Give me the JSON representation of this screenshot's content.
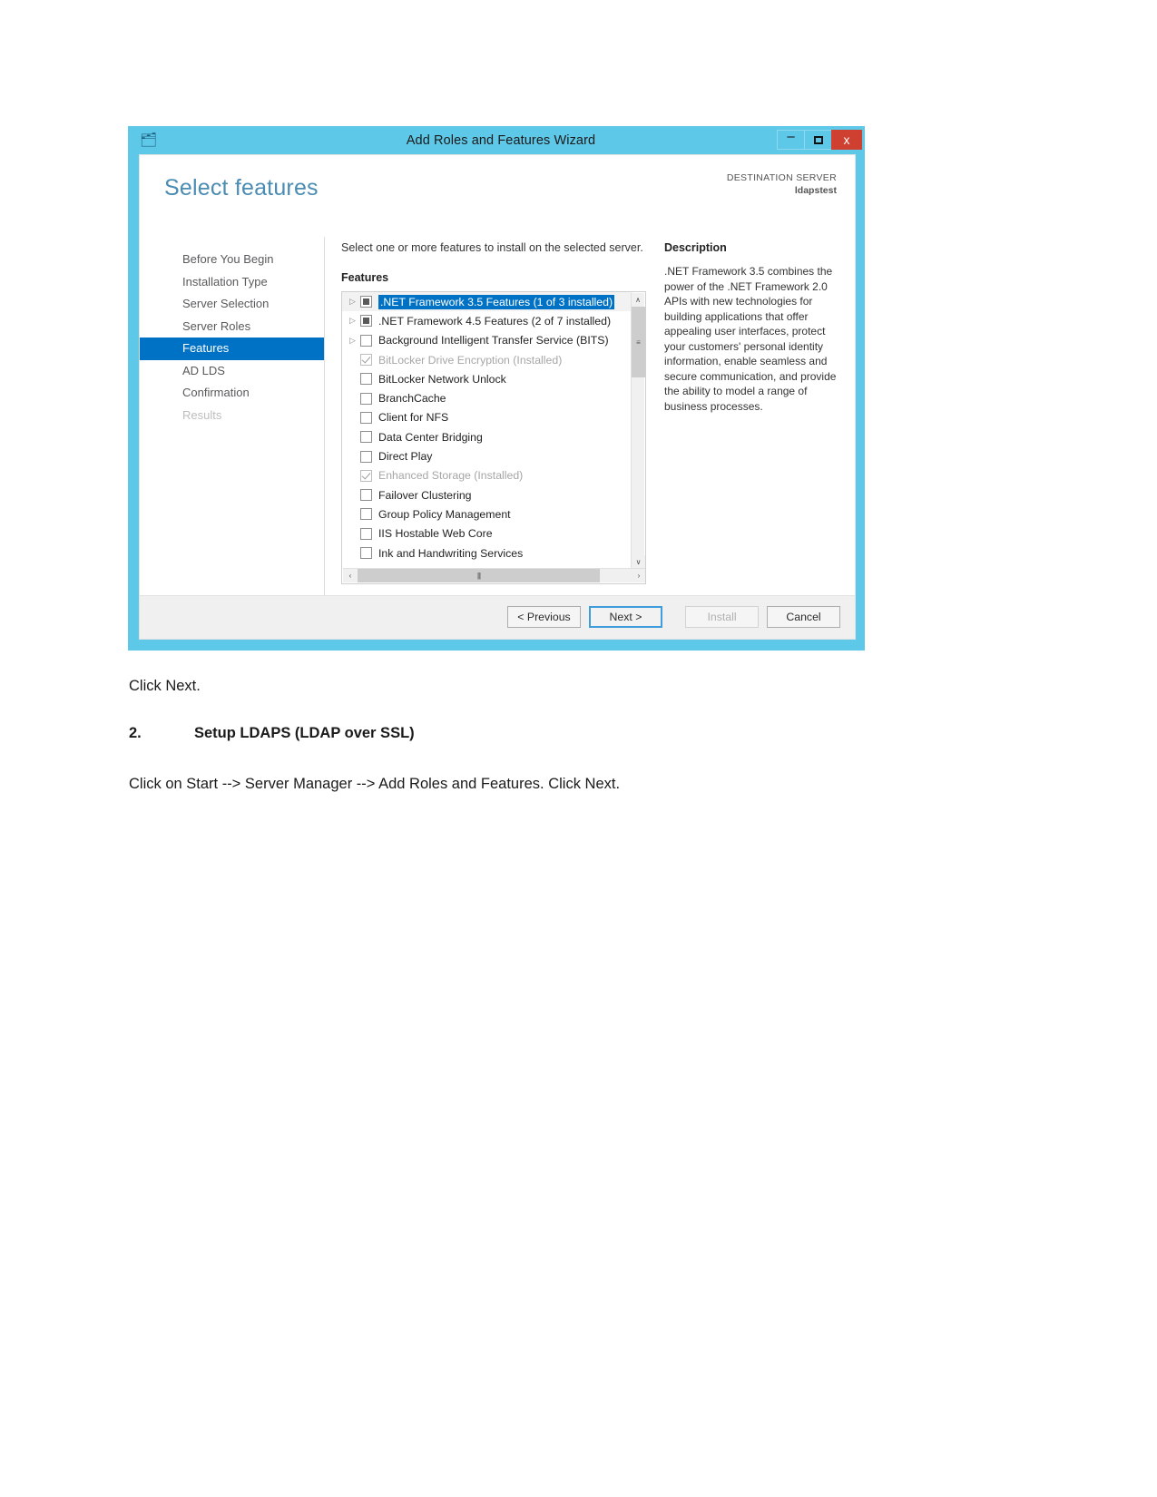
{
  "window": {
    "title": "Add Roles and Features Wizard",
    "icon": "wizard-app-icon",
    "minimize_label": "–",
    "maximize_label": "",
    "close_label": "x"
  },
  "header": {
    "page_title": "Select features",
    "destination_label": "DESTINATION SERVER",
    "destination_name": "ldapstest"
  },
  "nav": {
    "items": [
      {
        "label": "Before You Begin",
        "state": "normal"
      },
      {
        "label": "Installation Type",
        "state": "normal"
      },
      {
        "label": "Server Selection",
        "state": "normal"
      },
      {
        "label": "Server Roles",
        "state": "normal"
      },
      {
        "label": "Features",
        "state": "selected"
      },
      {
        "label": "AD LDS",
        "state": "normal"
      },
      {
        "label": "Confirmation",
        "state": "normal"
      },
      {
        "label": "Results",
        "state": "disabled"
      }
    ]
  },
  "main": {
    "instruction": "Select one or more features to install on the selected server.",
    "features_heading": "Features",
    "features": [
      {
        "label": ".NET Framework 3.5 Features (1 of 3 installed)",
        "expander": true,
        "check": "partial",
        "selected": true,
        "installed": false
      },
      {
        "label": ".NET Framework 4.5 Features (2 of 7 installed)",
        "expander": true,
        "check": "partial",
        "selected": false,
        "installed": false
      },
      {
        "label": "Background Intelligent Transfer Service (BITS)",
        "expander": true,
        "check": "empty",
        "selected": false,
        "installed": false
      },
      {
        "label": "BitLocker Drive Encryption (Installed)",
        "expander": false,
        "check": "checked-gray",
        "selected": false,
        "installed": true
      },
      {
        "label": "BitLocker Network Unlock",
        "expander": false,
        "check": "empty",
        "selected": false,
        "installed": false
      },
      {
        "label": "BranchCache",
        "expander": false,
        "check": "empty",
        "selected": false,
        "installed": false
      },
      {
        "label": "Client for NFS",
        "expander": false,
        "check": "empty",
        "selected": false,
        "installed": false
      },
      {
        "label": "Data Center Bridging",
        "expander": false,
        "check": "empty",
        "selected": false,
        "installed": false
      },
      {
        "label": "Direct Play",
        "expander": false,
        "check": "empty",
        "selected": false,
        "installed": false
      },
      {
        "label": "Enhanced Storage (Installed)",
        "expander": false,
        "check": "checked-gray",
        "selected": false,
        "installed": true
      },
      {
        "label": "Failover Clustering",
        "expander": false,
        "check": "empty",
        "selected": false,
        "installed": false
      },
      {
        "label": "Group Policy Management",
        "expander": false,
        "check": "empty",
        "selected": false,
        "installed": false
      },
      {
        "label": "IIS Hostable Web Core",
        "expander": false,
        "check": "empty",
        "selected": false,
        "installed": false
      },
      {
        "label": "Ink and Handwriting Services",
        "expander": false,
        "check": "empty",
        "selected": false,
        "installed": false
      }
    ],
    "scrollbar": {
      "up_arrow": "∧",
      "down_arrow": "∨",
      "left_arrow": "‹",
      "right_arrow": "›",
      "grip": "⫿ff"
    }
  },
  "description": {
    "heading": "Description",
    "body": ".NET Framework 3.5 combines the power of the .NET Framework 2.0 APIs with new technologies for building applications that offer appealing user interfaces, protect your customers' personal identity information, enable seamless and secure communication, and provide the ability to model a range of business processes."
  },
  "footer": {
    "previous_label": "< Previous",
    "next_label": "Next >",
    "install_label": "Install",
    "cancel_label": "Cancel"
  },
  "document": {
    "click_next": "Click Next.",
    "step_number": "2.",
    "step_heading": "Setup LDAPS (LDAP over SSL)",
    "step_body": "Click on Start --> Server Manager --> Add Roles and Features. Click Next."
  }
}
